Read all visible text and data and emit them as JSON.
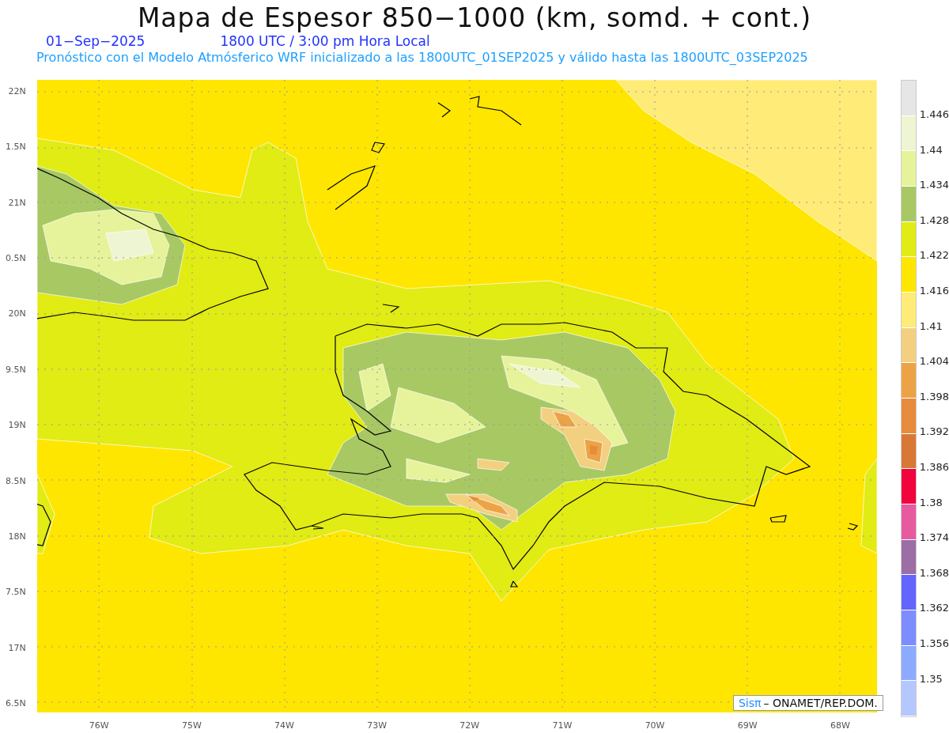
{
  "title": "Mapa de Espesor 850−1000 (km, somd. + cont.)",
  "date": "01−Sep−2025",
  "time": "1800 UTC / 3:00 pm Hora Local",
  "forecast": "Pronóstico con el Modelo Atmósferico WRF inicializado a las 1800UTC_01SEP2025 y válido hasta las  1800UTC_03SEP2025",
  "y_axis": [
    "22N",
    "1.5N",
    "21N",
    "0.5N",
    "20N",
    "9.5N",
    "19N",
    "8.5N",
    "18N",
    "7.5N",
    "17N",
    "6.5N"
  ],
  "x_axis": [
    "76W",
    "75W",
    "74W",
    "73W",
    "72W",
    "71W",
    "70W",
    "69W",
    "68W"
  ],
  "colorbar": {
    "swatches": [
      {
        "color": "#e6e6e6"
      },
      {
        "color": "#eef5d2"
      },
      {
        "color": "#e6f39a"
      },
      {
        "color": "#a8c864"
      },
      {
        "color": "#e1eb14"
      },
      {
        "color": "#ffe600"
      },
      {
        "color": "#ffeb78"
      },
      {
        "color": "#f3d080"
      },
      {
        "color": "#eba346"
      },
      {
        "color": "#e68c3c"
      },
      {
        "color": "#d97836"
      },
      {
        "color": "#f0053c"
      },
      {
        "color": "#e85aa0"
      },
      {
        "color": "#9b6ea6"
      },
      {
        "color": "#6464ff"
      },
      {
        "color": "#7d8cff"
      },
      {
        "color": "#8caaff"
      },
      {
        "color": "#b4c8ff"
      }
    ],
    "labels": [
      "1.446",
      "1.44",
      "1.434",
      "1.428",
      "1.422",
      "1.416",
      "1.41",
      "1.404",
      "1.398",
      "1.392",
      "1.386",
      "1.38",
      "1.374",
      "1.368",
      "1.362",
      "1.356",
      "1.35"
    ]
  },
  "credit": {
    "brand": "Sisπ",
    "text": "– ONAMET/REP.DOM."
  }
}
